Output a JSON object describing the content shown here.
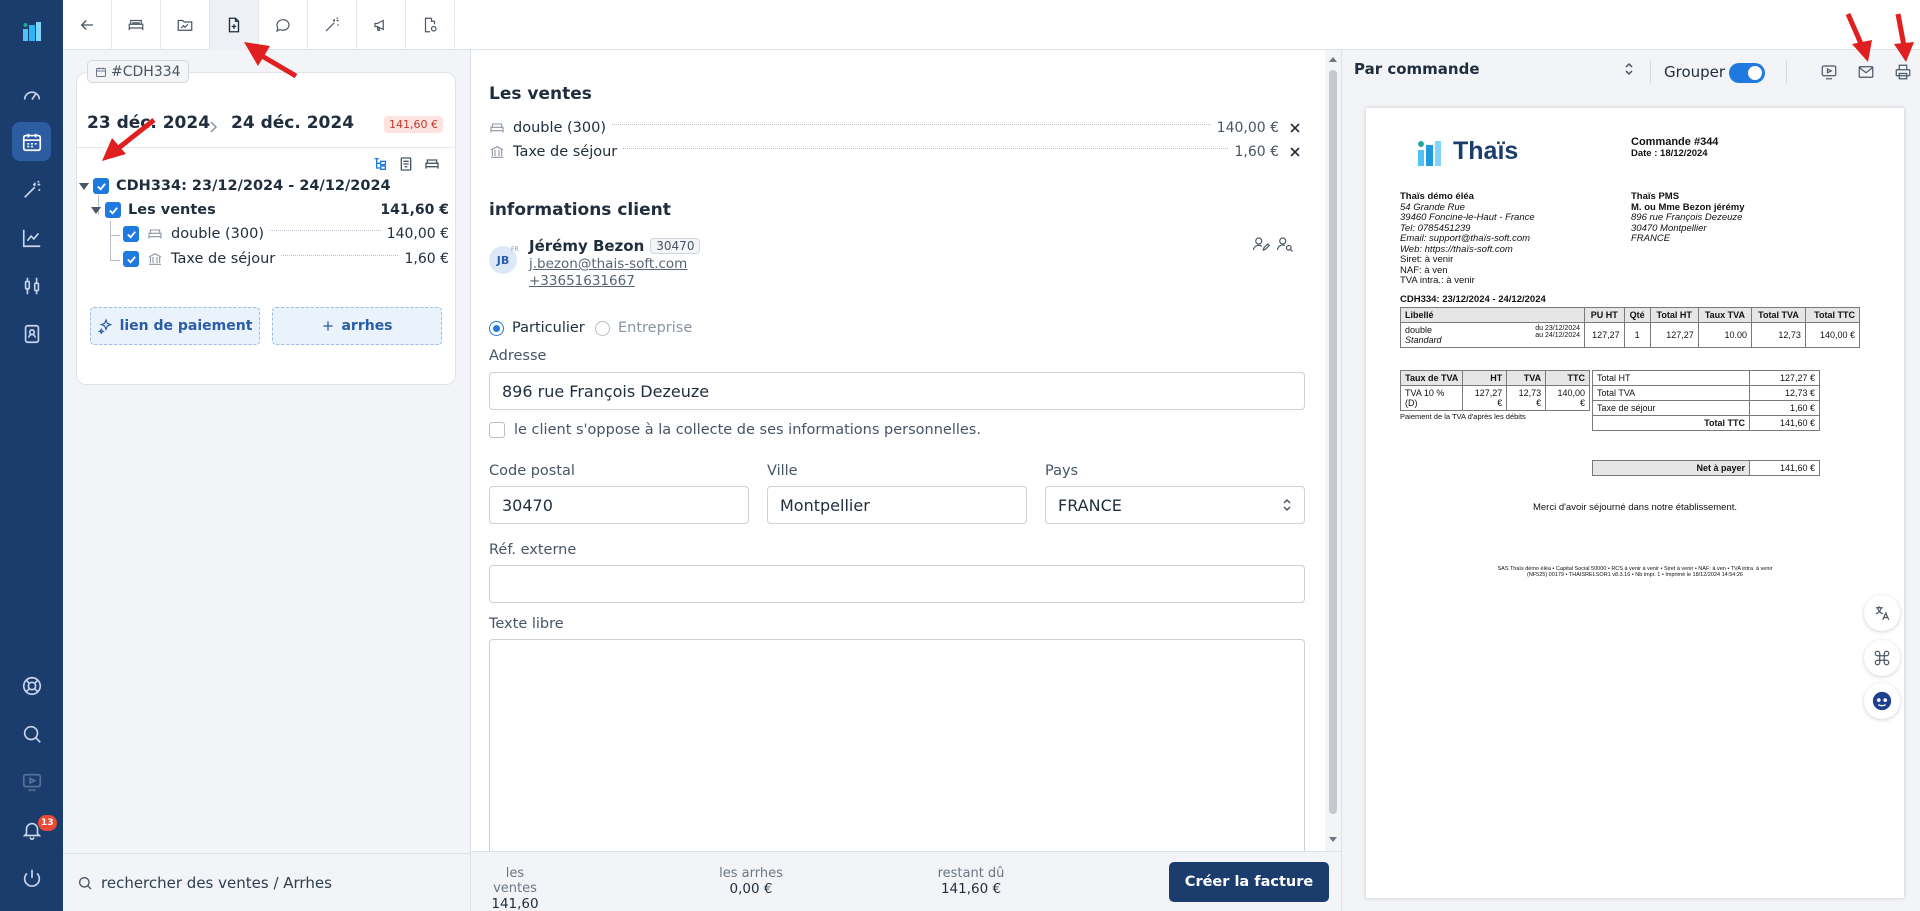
{
  "app": {
    "notifications_count": "13"
  },
  "booking": {
    "tag": "#CDH334",
    "date_from": "23 déc. 2024",
    "date_to": "24 déc. 2024",
    "total_badge": "141,60 €",
    "tree": {
      "root_label": "CDH334: 23/12/2024 - 24/12/2024",
      "group_label": "Les ventes",
      "group_total": "141,60 €",
      "items": [
        {
          "label": "double (300)",
          "amount": "140,00 €",
          "icon": "bed-icon"
        },
        {
          "label": "Taxe de séjour",
          "amount": "1,60 €",
          "icon": "bank-icon"
        }
      ]
    },
    "payment_link_label": "lien de paiement",
    "deposit_label": "arrhes"
  },
  "left_search": {
    "placeholder": "rechercher des ventes / Arrhes"
  },
  "sales": {
    "title": "Les ventes",
    "items": [
      {
        "label": "double (300)",
        "amount": "140,00 €"
      },
      {
        "label": "Taxe de séjour",
        "amount": "1,60 €"
      }
    ]
  },
  "client": {
    "title": "informations client",
    "avatar_initials": "JB",
    "avatar_lang": "FR",
    "name": "Jérémy Bezon",
    "client_id": "30470",
    "email": "j.bezon@thais-soft.com",
    "phone": "+33651631667",
    "type_individual": "Particulier",
    "type_company": "Entreprise",
    "address_label": "Adresse",
    "address": "896 rue François Dezeuze",
    "privacy_label": "le client s'oppose à la collecte de ses informations personnelles.",
    "postal_label": "Code postal",
    "postal": "30470",
    "city_label": "Ville",
    "city": "Montpellier",
    "country_label": "Pays",
    "country": "FRANCE",
    "ext_ref_label": "Réf. externe",
    "ext_ref": "",
    "free_text_label": "Texte libre",
    "free_text": ""
  },
  "footer": {
    "sales_label": "les ventes",
    "sales_value": "141,60 €",
    "deposit_label": "les arrhes",
    "deposit_value": "0,00 €",
    "due_label": "restant dû",
    "due_value": "141,60 €",
    "create_button": "Créer la facture"
  },
  "preview": {
    "order_select": "Par commande",
    "group_label": "Grouper",
    "group_on": true,
    "doc": {
      "logo_text": "Thaïs",
      "order_title": "Commande #344",
      "order_date": "Date : 18/12/2024",
      "seller": [
        "Thaïs démo éléa",
        "54 Grande Rue",
        "39460 Foncine-le-Haut - France",
        "Tel: 0785451239",
        "Email: support@thaïs-soft.com",
        "Web: https://thaïs-soft.com",
        "Siret: à venir",
        "NAF: à ven",
        "TVA intra.: à venir"
      ],
      "buyer": [
        "Thaïs PMS",
        "M. ou Mme Bezon jérémy",
        "896 rue François Dezeuze",
        "30470 Montpellier",
        "FRANCE"
      ],
      "section_title": "CDH334: 23/12/2024 - 24/12/2024",
      "lines_headers": [
        "Libellé",
        "PU HT",
        "Qté",
        "Total HT",
        "Taux TVA",
        "Total TVA",
        "Total TTC"
      ],
      "line": {
        "name": "double",
        "sub": "Standard",
        "from": "du 23/12/2024",
        "to": "au 24/12/2024",
        "pu_ht": "127,27",
        "qty": "1",
        "total_ht": "127,27",
        "vat_rate": "10.00",
        "total_vat": "12,73",
        "total_ttc": "140,00 €"
      },
      "vat_headers": [
        "Taux de TVA",
        "HT",
        "TVA",
        "TTC"
      ],
      "vat_row": [
        "TVA 10 % (D)",
        "127,27 €",
        "12,73 €",
        "140,00 €"
      ],
      "vat_note": "Paiement de la TVA d'après les débits",
      "totals": [
        {
          "label": "Total HT",
          "value": "127,27 €"
        },
        {
          "label": "Total TVA",
          "value": "12,73 €"
        },
        {
          "label": "Taxe de séjour",
          "value": "1,60 €"
        },
        {
          "label": "Total TTC",
          "value": "141,60 €"
        }
      ],
      "net_label": "Net à payer",
      "net_value": "141,60 €",
      "thanks": "Merci d'avoir séjourné dans notre établissement.",
      "legal_1": "SAS Thaïs démo éléa • Capital Social 50000 • RCS à venir à venir • Siret à venir • NAF: à ven • TVA intra. à venir",
      "legal_2": "(NF525) 00179 • THAISRELSOR1 v8.3.16 • Nb impr. 1 • Imprimé le 18/12/2024 14:54:26"
    }
  },
  "colors": {
    "nav_bg": "#1b3d6e",
    "accent": "#1f7ae0",
    "danger": "#c2392b"
  }
}
